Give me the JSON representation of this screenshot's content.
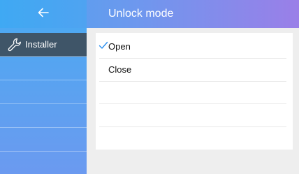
{
  "header": {
    "back_icon": "arrow-left-icon",
    "title": "Unlock mode"
  },
  "sidebar": {
    "items": [
      {
        "label": "Installer",
        "icon": "wrench-icon",
        "active": true
      }
    ]
  },
  "options": [
    {
      "label": "Open",
      "selected": true
    },
    {
      "label": "Close",
      "selected": false
    }
  ],
  "colors": {
    "accent_check": "#2a8ff0",
    "sidebar_active": "#3f5568",
    "header_gradient_start": "#4aa6f0",
    "header_gradient_end": "#9a7fe8"
  }
}
